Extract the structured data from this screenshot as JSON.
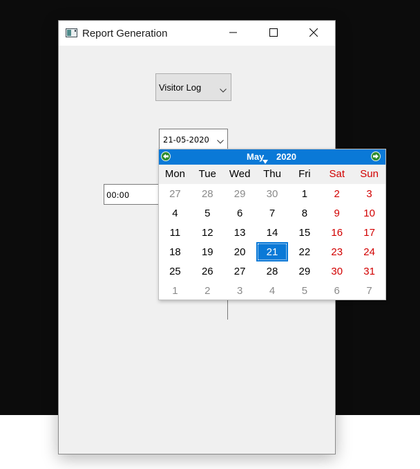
{
  "window": {
    "title": "Report Generation",
    "icon": "app-window-icon"
  },
  "report_type": {
    "selected": "Visitor Log"
  },
  "date_picker": {
    "value": "21-05-2020"
  },
  "time_input": {
    "value": "00:00"
  },
  "calendar": {
    "month": "May",
    "year": "2020",
    "weekdays": [
      "Mon",
      "Tue",
      "Wed",
      "Thu",
      "Fri",
      "Sat",
      "Sun"
    ],
    "weeks": [
      [
        "27",
        "28",
        "29",
        "30",
        "1",
        "2",
        "3"
      ],
      [
        "4",
        "5",
        "6",
        "7",
        "8",
        "9",
        "10"
      ],
      [
        "11",
        "12",
        "13",
        "14",
        "15",
        "16",
        "17"
      ],
      [
        "18",
        "19",
        "20",
        "21",
        "22",
        "23",
        "24"
      ],
      [
        "25",
        "26",
        "27",
        "28",
        "29",
        "30",
        "31"
      ],
      [
        "1",
        "2",
        "3",
        "4",
        "5",
        "6",
        "7"
      ]
    ],
    "selected_day": "21",
    "colors": {
      "header": "#0a79d7",
      "weekend": "#d20000",
      "muted": "#8a8a8a",
      "nav_arrow": "#2e8b2e"
    }
  }
}
